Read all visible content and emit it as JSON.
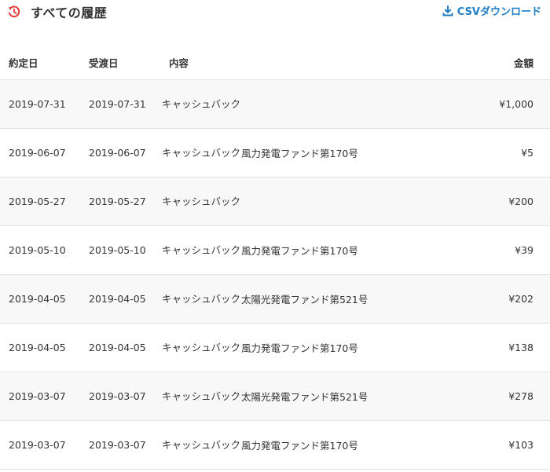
{
  "header": {
    "title": "すべての履歴",
    "icon": "history-icon",
    "csv_label": "CSVダウンロード",
    "csv_icon": "download-icon",
    "accent_color": "#1e7ec3",
    "icon_color": "#e4302c"
  },
  "table": {
    "columns": {
      "contract_date": "約定日",
      "delivery_date": "受渡日",
      "content": "内容",
      "fund": "",
      "amount": "金額"
    },
    "rows": [
      {
        "contract_date": "2019-07-31",
        "delivery_date": "2019-07-31",
        "type": "キャッシュバック",
        "fund": "",
        "amount": "¥1,000"
      },
      {
        "contract_date": "2019-06-07",
        "delivery_date": "2019-06-07",
        "type": "キャッシュバック",
        "fund": "風力発電ファンド第170号",
        "amount": "¥5"
      },
      {
        "contract_date": "2019-05-27",
        "delivery_date": "2019-05-27",
        "type": "キャッシュバック",
        "fund": "",
        "amount": "¥200"
      },
      {
        "contract_date": "2019-05-10",
        "delivery_date": "2019-05-10",
        "type": "キャッシュバック",
        "fund": "風力発電ファンド第170号",
        "amount": "¥39"
      },
      {
        "contract_date": "2019-04-05",
        "delivery_date": "2019-04-05",
        "type": "キャッシュバック",
        "fund": "太陽光発電ファンド第521号",
        "amount": "¥202"
      },
      {
        "contract_date": "2019-04-05",
        "delivery_date": "2019-04-05",
        "type": "キャッシュバック",
        "fund": "風力発電ファンド第170号",
        "amount": "¥138"
      },
      {
        "contract_date": "2019-03-07",
        "delivery_date": "2019-03-07",
        "type": "キャッシュバック",
        "fund": "太陽光発電ファンド第521号",
        "amount": "¥278"
      },
      {
        "contract_date": "2019-03-07",
        "delivery_date": "2019-03-07",
        "type": "キャッシュバック",
        "fund": "風力発電ファンド第170号",
        "amount": "¥103"
      }
    ]
  }
}
